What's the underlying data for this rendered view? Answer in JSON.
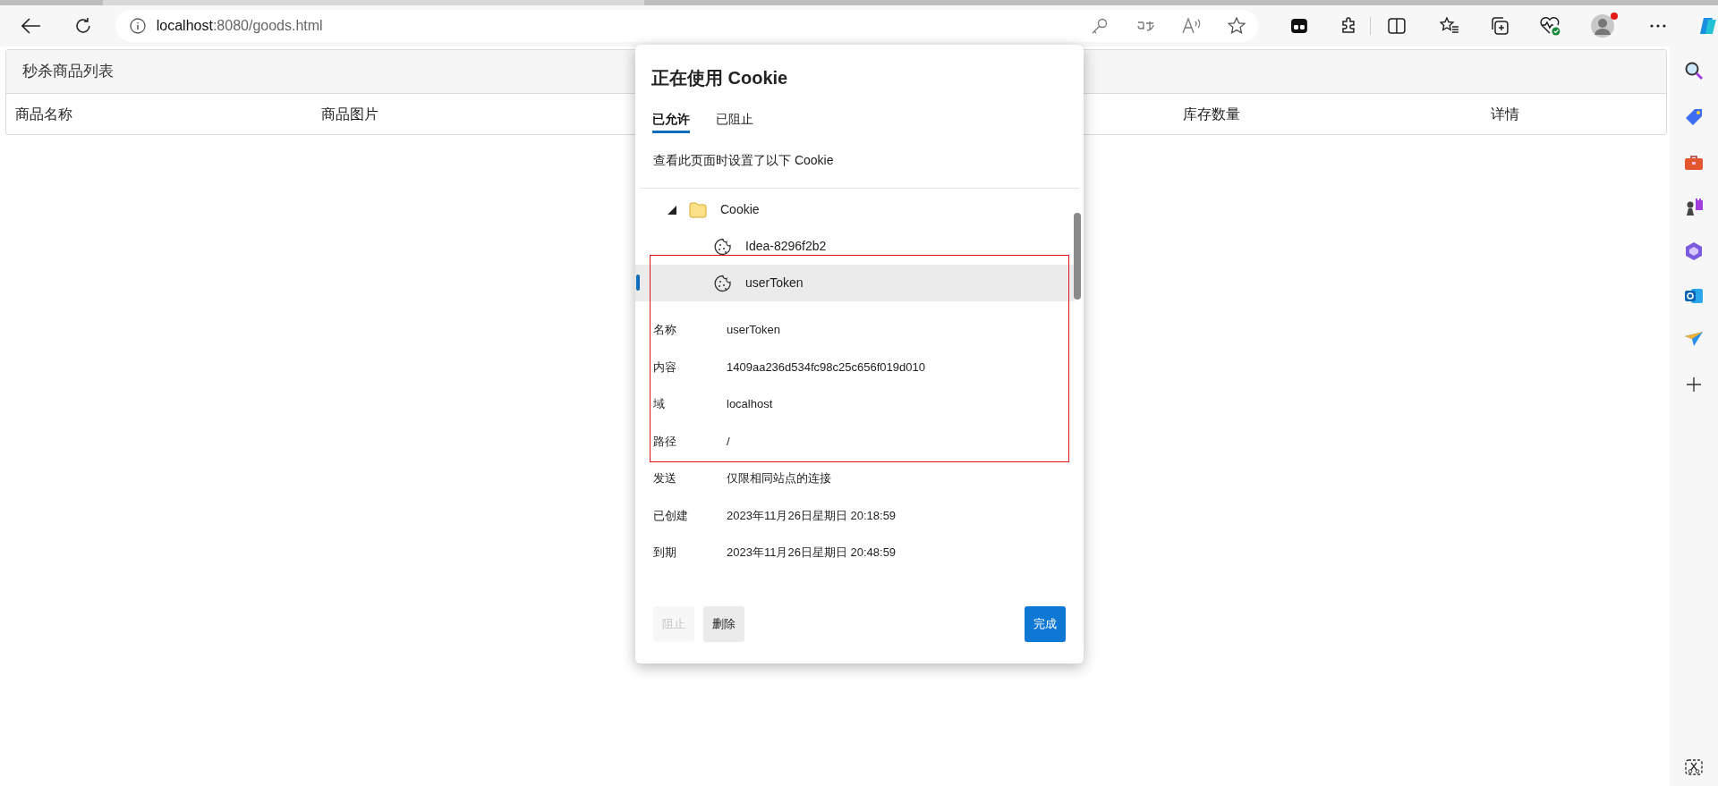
{
  "browser": {
    "url_host": "localhost",
    "url_rest": ":8080/goods.html"
  },
  "page": {
    "panel_title": "秒杀商品列表",
    "columns": [
      "商品名称",
      "商品图片",
      "库存数量",
      "详情"
    ]
  },
  "dialog": {
    "title": "正在使用 Cookie",
    "tabs": [
      {
        "label": "已允许",
        "selected": true
      },
      {
        "label": "已阻止",
        "selected": false
      }
    ],
    "description": "查看此页面时设置了以下 Cookie",
    "tree": [
      {
        "label": "Cookie",
        "kind": "folder",
        "expanded": true,
        "selected": false,
        "children": [
          {
            "label": "Idea-8296f2b2",
            "kind": "cookie",
            "selected": false
          },
          {
            "label": "userToken",
            "kind": "cookie",
            "selected": true
          }
        ]
      }
    ],
    "details": [
      {
        "label": "名称",
        "value": "userToken"
      },
      {
        "label": "内容",
        "value": "1409aa236d534fc98c25c656f019d010"
      },
      {
        "label": "域",
        "value": "localhost"
      },
      {
        "label": "路径",
        "value": "/"
      },
      {
        "label": "发送",
        "value": "仅限相同站点的连接"
      },
      {
        "label": "已创建",
        "value": "2023年11月26日星期日 20:18:59"
      },
      {
        "label": "到期",
        "value": "2023年11月26日星期日 20:48:59"
      }
    ],
    "buttons": [
      {
        "label": "阻止",
        "kind": "secondary",
        "disabled": true
      },
      {
        "label": "删除",
        "kind": "secondary",
        "disabled": false
      },
      {
        "label": "完成",
        "kind": "primary",
        "disabled": false
      }
    ]
  }
}
